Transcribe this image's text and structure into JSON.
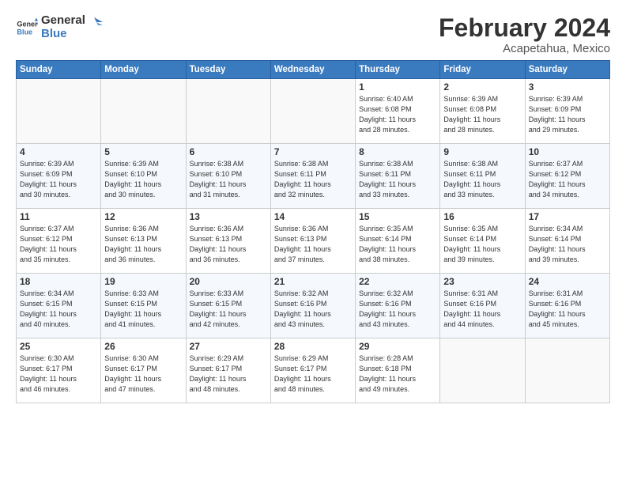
{
  "logo": {
    "line1": "General",
    "line2": "Blue"
  },
  "title": "February 2024",
  "location": "Acapetahua, Mexico",
  "days_of_week": [
    "Sunday",
    "Monday",
    "Tuesday",
    "Wednesday",
    "Thursday",
    "Friday",
    "Saturday"
  ],
  "weeks": [
    [
      {
        "day": "",
        "detail": ""
      },
      {
        "day": "",
        "detail": ""
      },
      {
        "day": "",
        "detail": ""
      },
      {
        "day": "",
        "detail": ""
      },
      {
        "day": "1",
        "detail": "Sunrise: 6:40 AM\nSunset: 6:08 PM\nDaylight: 11 hours\nand 28 minutes."
      },
      {
        "day": "2",
        "detail": "Sunrise: 6:39 AM\nSunset: 6:08 PM\nDaylight: 11 hours\nand 28 minutes."
      },
      {
        "day": "3",
        "detail": "Sunrise: 6:39 AM\nSunset: 6:09 PM\nDaylight: 11 hours\nand 29 minutes."
      }
    ],
    [
      {
        "day": "4",
        "detail": "Sunrise: 6:39 AM\nSunset: 6:09 PM\nDaylight: 11 hours\nand 30 minutes."
      },
      {
        "day": "5",
        "detail": "Sunrise: 6:39 AM\nSunset: 6:10 PM\nDaylight: 11 hours\nand 30 minutes."
      },
      {
        "day": "6",
        "detail": "Sunrise: 6:38 AM\nSunset: 6:10 PM\nDaylight: 11 hours\nand 31 minutes."
      },
      {
        "day": "7",
        "detail": "Sunrise: 6:38 AM\nSunset: 6:11 PM\nDaylight: 11 hours\nand 32 minutes."
      },
      {
        "day": "8",
        "detail": "Sunrise: 6:38 AM\nSunset: 6:11 PM\nDaylight: 11 hours\nand 33 minutes."
      },
      {
        "day": "9",
        "detail": "Sunrise: 6:38 AM\nSunset: 6:11 PM\nDaylight: 11 hours\nand 33 minutes."
      },
      {
        "day": "10",
        "detail": "Sunrise: 6:37 AM\nSunset: 6:12 PM\nDaylight: 11 hours\nand 34 minutes."
      }
    ],
    [
      {
        "day": "11",
        "detail": "Sunrise: 6:37 AM\nSunset: 6:12 PM\nDaylight: 11 hours\nand 35 minutes."
      },
      {
        "day": "12",
        "detail": "Sunrise: 6:36 AM\nSunset: 6:13 PM\nDaylight: 11 hours\nand 36 minutes."
      },
      {
        "day": "13",
        "detail": "Sunrise: 6:36 AM\nSunset: 6:13 PM\nDaylight: 11 hours\nand 36 minutes."
      },
      {
        "day": "14",
        "detail": "Sunrise: 6:36 AM\nSunset: 6:13 PM\nDaylight: 11 hours\nand 37 minutes."
      },
      {
        "day": "15",
        "detail": "Sunrise: 6:35 AM\nSunset: 6:14 PM\nDaylight: 11 hours\nand 38 minutes."
      },
      {
        "day": "16",
        "detail": "Sunrise: 6:35 AM\nSunset: 6:14 PM\nDaylight: 11 hours\nand 39 minutes."
      },
      {
        "day": "17",
        "detail": "Sunrise: 6:34 AM\nSunset: 6:14 PM\nDaylight: 11 hours\nand 39 minutes."
      }
    ],
    [
      {
        "day": "18",
        "detail": "Sunrise: 6:34 AM\nSunset: 6:15 PM\nDaylight: 11 hours\nand 40 minutes."
      },
      {
        "day": "19",
        "detail": "Sunrise: 6:33 AM\nSunset: 6:15 PM\nDaylight: 11 hours\nand 41 minutes."
      },
      {
        "day": "20",
        "detail": "Sunrise: 6:33 AM\nSunset: 6:15 PM\nDaylight: 11 hours\nand 42 minutes."
      },
      {
        "day": "21",
        "detail": "Sunrise: 6:32 AM\nSunset: 6:16 PM\nDaylight: 11 hours\nand 43 minutes."
      },
      {
        "day": "22",
        "detail": "Sunrise: 6:32 AM\nSunset: 6:16 PM\nDaylight: 11 hours\nand 43 minutes."
      },
      {
        "day": "23",
        "detail": "Sunrise: 6:31 AM\nSunset: 6:16 PM\nDaylight: 11 hours\nand 44 minutes."
      },
      {
        "day": "24",
        "detail": "Sunrise: 6:31 AM\nSunset: 6:16 PM\nDaylight: 11 hours\nand 45 minutes."
      }
    ],
    [
      {
        "day": "25",
        "detail": "Sunrise: 6:30 AM\nSunset: 6:17 PM\nDaylight: 11 hours\nand 46 minutes."
      },
      {
        "day": "26",
        "detail": "Sunrise: 6:30 AM\nSunset: 6:17 PM\nDaylight: 11 hours\nand 47 minutes."
      },
      {
        "day": "27",
        "detail": "Sunrise: 6:29 AM\nSunset: 6:17 PM\nDaylight: 11 hours\nand 48 minutes."
      },
      {
        "day": "28",
        "detail": "Sunrise: 6:29 AM\nSunset: 6:17 PM\nDaylight: 11 hours\nand 48 minutes."
      },
      {
        "day": "29",
        "detail": "Sunrise: 6:28 AM\nSunset: 6:18 PM\nDaylight: 11 hours\nand 49 minutes."
      },
      {
        "day": "",
        "detail": ""
      },
      {
        "day": "",
        "detail": ""
      }
    ]
  ]
}
